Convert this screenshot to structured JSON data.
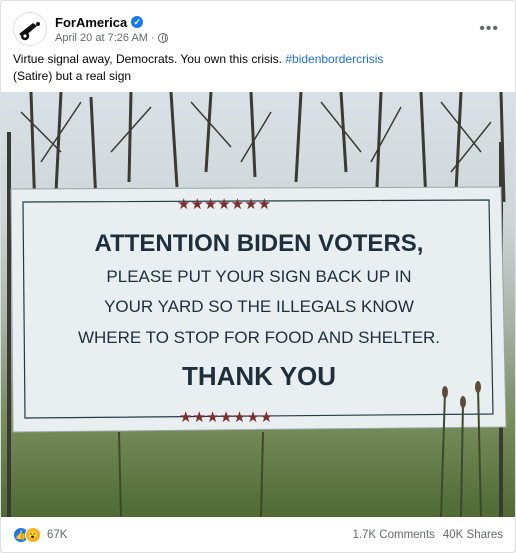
{
  "post": {
    "author": "ForAmerica",
    "timestamp": "April 20 at 7:26 AM",
    "audience_icon": "globe-icon",
    "more_icon": "more-options-icon",
    "text_main": "Virtue signal away, Democrats. You own this crisis. ",
    "hashtag": "#bidenbordercrisis",
    "text_sub": "(Satire) but a real sign"
  },
  "sign": {
    "line1": "ATTENTION BIDEN VOTERS,",
    "line2": "PLEASE PUT YOUR SIGN BACK UP IN",
    "line3": "YOUR YARD SO THE ILLEGALS KNOW",
    "line4": "WHERE TO STOP FOR FOOD AND SHELTER.",
    "line5": "THANK YOU",
    "star_color": "#7a2e2e"
  },
  "engagement": {
    "reactions_count": "67K",
    "comments": "1.7K Comments",
    "shares": "40K Shares"
  },
  "colors": {
    "accent": "#1877f2",
    "hashtag": "#216fdb"
  }
}
